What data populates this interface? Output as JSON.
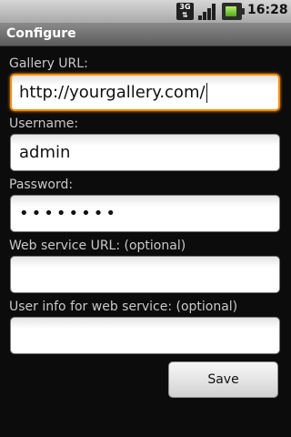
{
  "status_bar": {
    "network_label": "3G",
    "time": "16:28"
  },
  "title_bar": {
    "title": "Configure"
  },
  "form": {
    "gallery_url": {
      "label": "Gallery URL:",
      "value": "http://yourgallery.com/"
    },
    "username": {
      "label": "Username:",
      "value": "admin"
    },
    "password": {
      "label": "Password:",
      "value": "••••••••"
    },
    "web_service_url": {
      "label": "Web service URL: (optional)",
      "value": ""
    },
    "user_info": {
      "label": "User info for web service: (optional)",
      "value": ""
    }
  },
  "actions": {
    "save_label": "Save"
  },
  "colors": {
    "focus_border": "#ff8a00",
    "background": "#0c0c0c"
  }
}
